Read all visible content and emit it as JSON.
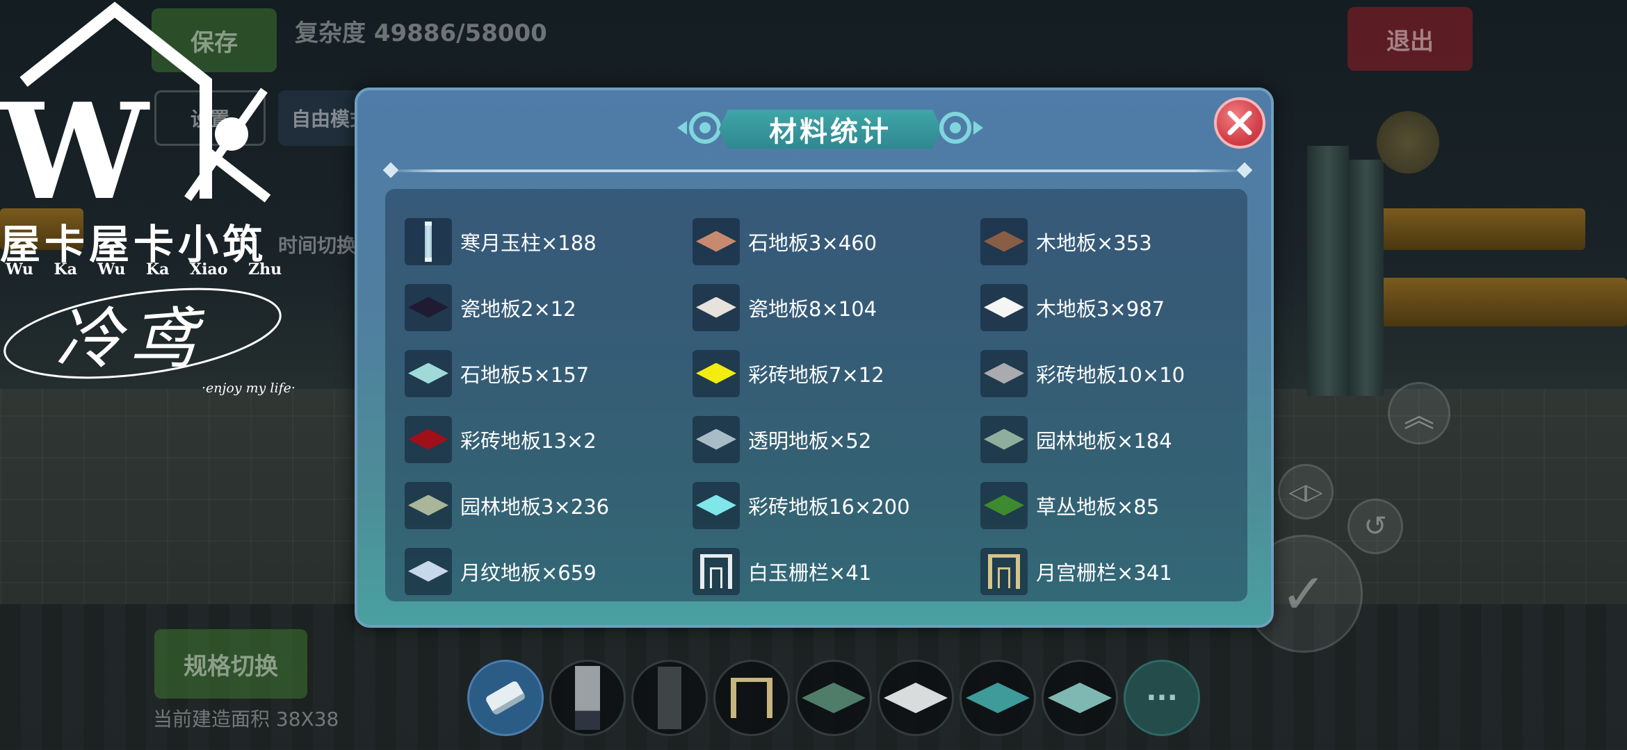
{
  "hud": {
    "save_label": "保存",
    "complexity": "复杂度 49886/58000",
    "exit_label": "退出",
    "settings_label": "设置",
    "free_label": "自由模式",
    "time_switch_label": "时间切换",
    "spec_switch_label": "规格切换",
    "build_area": "当前建造面积 38X38",
    "more_label": "···"
  },
  "watermark": {
    "title": "屋卡屋卡小筑",
    "pinyin": "Wu Ka Wu Ka Xiao Zhu",
    "signature": "冷鸢",
    "tagline": "·enjoy my life·"
  },
  "dialog": {
    "title": "材料统计",
    "close_icon": "close-x-icon",
    "materials": [
      {
        "label": "寒月玉柱×188",
        "icon": "pillar-icon",
        "color": "#cfe6ee"
      },
      {
        "label": "石地板3×460",
        "icon": "tile-icon",
        "color": "#c78a6e"
      },
      {
        "label": "木地板×353",
        "icon": "tile-icon",
        "color": "#8a5d45"
      },
      {
        "label": "瓷地板2×12",
        "icon": "tile-icon",
        "color": "#201b33"
      },
      {
        "label": "瓷地板8×104",
        "icon": "tile-icon",
        "color": "#e8e2dc"
      },
      {
        "label": "木地板3×987",
        "icon": "tile-icon",
        "color": "#f5f5f5"
      },
      {
        "label": "石地板5×157",
        "icon": "tile-icon",
        "color": "#9fdad8"
      },
      {
        "label": "彩砖地板7×12",
        "icon": "tile-icon",
        "color": "#f2ec0f"
      },
      {
        "label": "彩砖地板10×10",
        "icon": "tile-icon",
        "color": "#a9abae"
      },
      {
        "label": "彩砖地板13×2",
        "icon": "tile-icon",
        "color": "#a0101a"
      },
      {
        "label": "透明地板×52",
        "icon": "tile-icon",
        "color": "#a8bcc8"
      },
      {
        "label": "园林地板×184",
        "icon": "tile-icon",
        "color": "#8fae9b"
      },
      {
        "label": "园林地板3×236",
        "icon": "tile-icon",
        "color": "#a9b69a"
      },
      {
        "label": "彩砖地板16×200",
        "icon": "tile-icon",
        "color": "#7fe6ea"
      },
      {
        "label": "草丛地板×85",
        "icon": "tile-icon",
        "color": "#3e8a2e"
      },
      {
        "label": "月纹地板×659",
        "icon": "tile-icon",
        "color": "#c7d8ea"
      },
      {
        "label": "白玉栅栏×41",
        "icon": "fence-icon",
        "color": "#e8ecef"
      },
      {
        "label": "月宫栅栏×341",
        "icon": "fence-icon",
        "color": "#d6c58a"
      }
    ]
  },
  "hotbar": [
    {
      "icon": "eraser-icon",
      "active": true
    },
    {
      "icon": "brick-wall-icon"
    },
    {
      "icon": "dark-wall-icon"
    },
    {
      "icon": "fence-icon"
    },
    {
      "icon": "green-tile-icon",
      "color": "#4f7d6a"
    },
    {
      "icon": "white-tile-icon",
      "color": "#d8dcdc"
    },
    {
      "icon": "teal-tile-icon",
      "color": "#3f9a9a"
    },
    {
      "icon": "light-teal-tile-icon",
      "color": "#7fb8b2"
    },
    {
      "icon": "more-icon"
    }
  ]
}
